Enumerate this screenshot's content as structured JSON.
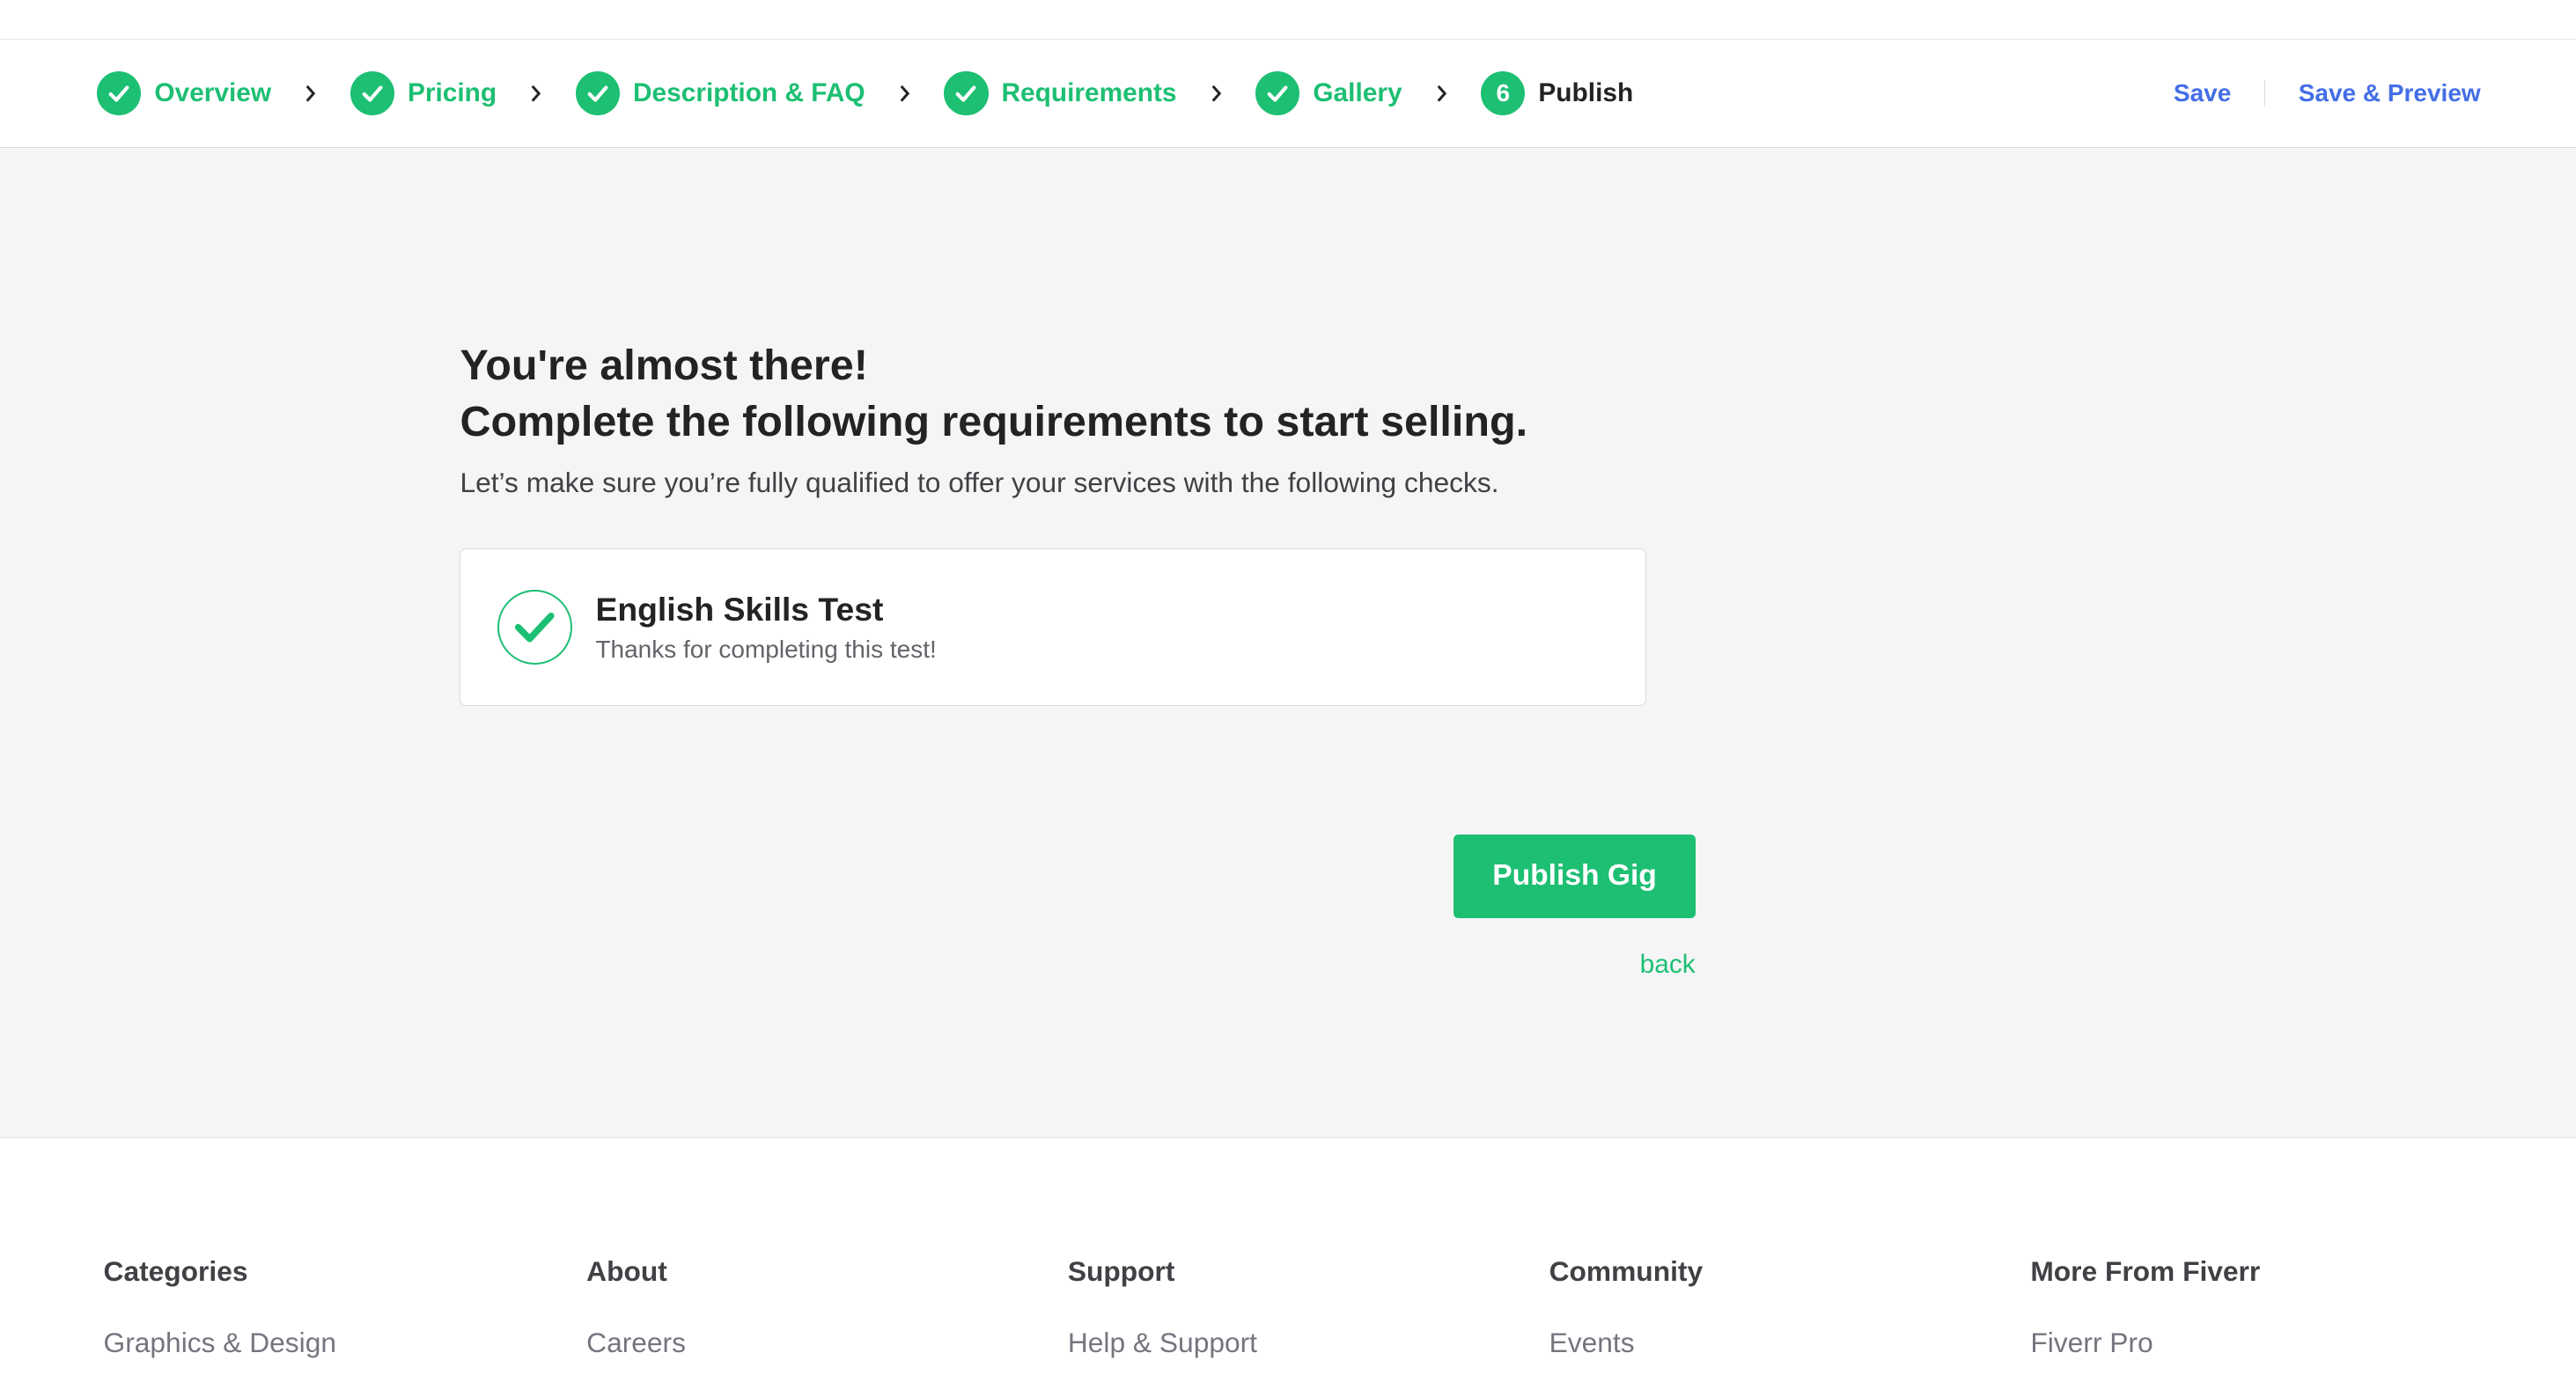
{
  "stepbar": {
    "steps": [
      {
        "label": "Overview",
        "done": true
      },
      {
        "label": "Pricing",
        "done": true
      },
      {
        "label": "Description & FAQ",
        "done": true
      },
      {
        "label": "Requirements",
        "done": true
      },
      {
        "label": "Gallery",
        "done": true
      },
      {
        "label": "Publish",
        "number": "6",
        "done": false
      }
    ],
    "save_label": "Save",
    "save_preview_label": "Save & Preview"
  },
  "main": {
    "heading_line1": "You're almost there!",
    "heading_line2": "Complete the following requirements to start selling.",
    "subtitle": "Let’s make sure you’re fully qualified to offer your services with the following checks.",
    "card": {
      "title": "English Skills Test",
      "description": "Thanks for completing this test!"
    },
    "publish_label": "Publish Gig",
    "back_label": "back"
  },
  "footer": {
    "columns": [
      {
        "heading": "Categories",
        "first_link": "Graphics & Design"
      },
      {
        "heading": "About",
        "first_link": "Careers"
      },
      {
        "heading": "Support",
        "first_link": "Help & Support"
      },
      {
        "heading": "Community",
        "first_link": "Events"
      },
      {
        "heading": "More From Fiverr",
        "first_link": "Fiverr Pro"
      }
    ]
  },
  "colors": {
    "accent_green": "#1dbf73",
    "link_blue": "#446ee7",
    "page_bg": "#f5f5f5"
  }
}
